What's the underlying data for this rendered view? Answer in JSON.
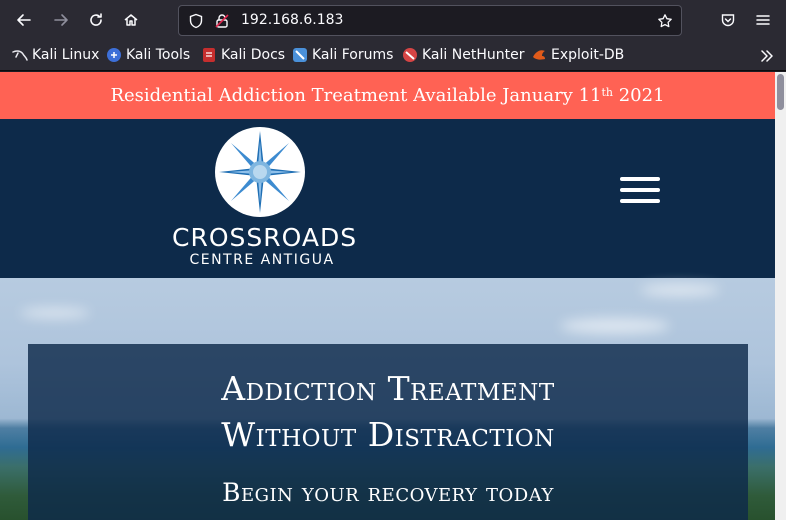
{
  "browser": {
    "url": "192.168.6.183",
    "bookmarks": [
      {
        "label": "Kali Linux",
        "icon": "kali-dragon-icon",
        "color": "#2b2a33"
      },
      {
        "label": "Kali Tools",
        "icon": "kali-tools-icon",
        "color": "#3d6fd8"
      },
      {
        "label": "Kali Docs",
        "icon": "kali-docs-icon",
        "color": "#d13b3b"
      },
      {
        "label": "Kali Forums",
        "icon": "kali-forums-icon",
        "color": "#4a90d9"
      },
      {
        "label": "Kali NetHunter",
        "icon": "kali-nethunter-icon",
        "color": "#d64545"
      },
      {
        "label": "Exploit-DB",
        "icon": "exploit-db-icon",
        "color": "#e05a1a"
      }
    ]
  },
  "page": {
    "announcement": {
      "text_before": "Residential Addiction Treatment Available January 11",
      "superscript": "th",
      "text_after": " 2021"
    },
    "logo": {
      "title": "CROSSROADS",
      "subtitle": "CENTRE ANTIGUA"
    },
    "hero": {
      "heading_line1": "Addiction Treatment",
      "heading_line2": "Without Distraction",
      "subheading": "Begin your recovery today"
    },
    "colors": {
      "announcement_bg": "#ff6254",
      "header_bg": "#0d2a4a",
      "accent_blue": "#1f6fb4"
    }
  }
}
